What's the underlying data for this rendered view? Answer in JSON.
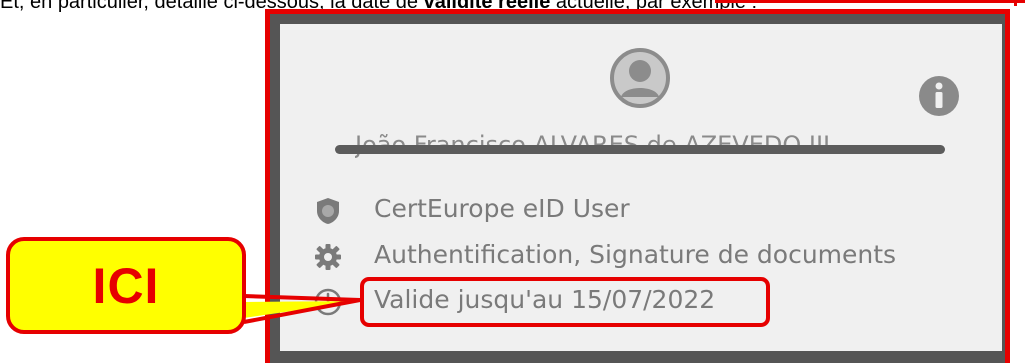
{
  "top_text": {
    "before": "Et, en particulier, détaillé ci-dessous, la date de ",
    "bold": "validité réelle",
    "after": " actuelle, par exemple :"
  },
  "card": {
    "name": "João Francisco ALVARES de AZEVEDO III",
    "certificate": "CertEurope eID User",
    "usage": "Authentification, Signature de documents",
    "validity": "Valide jusqu'au 15/07/2022"
  },
  "callout": {
    "label": "ICI"
  },
  "icons": {
    "avatar": "user-avatar-icon",
    "info": "info-icon",
    "certificate": "shield-icon",
    "usage": "gear-icon",
    "validity": "clock-icon"
  },
  "colors": {
    "highlight": "#e60000",
    "callout_fill": "#ffff00",
    "card_background": "#f0f0f0",
    "frame_background": "#555555"
  }
}
